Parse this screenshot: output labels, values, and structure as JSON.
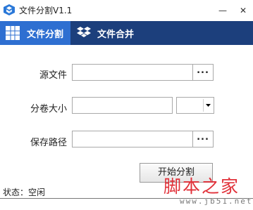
{
  "window": {
    "title": "文件分割V1.1",
    "minimize_label": "—",
    "close_label": "✕",
    "icon": "dropbox-box-icon"
  },
  "tabs": [
    {
      "label": "文件分割",
      "icon": "grid-icon",
      "active": true
    },
    {
      "label": "文件合并",
      "icon": "dropbox-icon",
      "active": false
    }
  ],
  "form": {
    "source_file": {
      "label": "源文件",
      "value": "",
      "browse_label": "..."
    },
    "volume_size": {
      "label": "分卷大小",
      "value": "",
      "unit_selected": ""
    },
    "save_path": {
      "label": "保存路径",
      "value": "",
      "browse_label": "..."
    }
  },
  "actions": {
    "start_label": "开始分割"
  },
  "status": {
    "text": "状态：空闲"
  },
  "watermark": {
    "text_cn": "脚本之家",
    "text_en": "www.jb51.net"
  },
  "colors": {
    "tabbar_bg": "#1c3f7c",
    "tab_active_bg": "#2e6fd1",
    "watermark_red": "#e0262f"
  }
}
